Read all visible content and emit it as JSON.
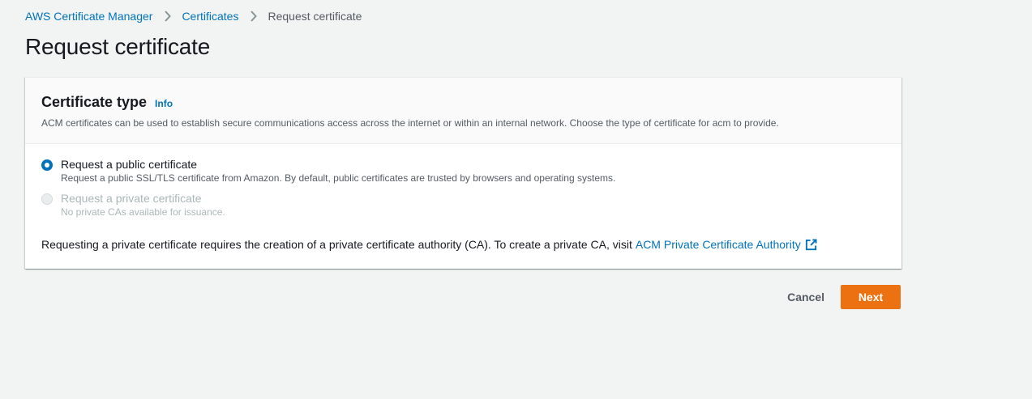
{
  "breadcrumb": {
    "items": [
      "AWS Certificate Manager",
      "Certificates"
    ],
    "current": "Request certificate"
  },
  "page": {
    "title": "Request certificate"
  },
  "panel": {
    "title": "Certificate type",
    "info": "Info",
    "description": "ACM certificates can be used to establish secure communications access across the internet or within an internal network. Choose the type of certificate for acm to provide.",
    "options": [
      {
        "label": "Request a public certificate",
        "description": "Request a public SSL/TLS certificate from Amazon. By default, public certificates are trusted by browsers and operating systems.",
        "selected": true,
        "disabled": false
      },
      {
        "label": "Request a private certificate",
        "description": "No private CAs available for issuance.",
        "selected": false,
        "disabled": true
      }
    ],
    "note": "Requesting a private certificate requires the creation of a private certificate authority (CA). To create a private CA, visit",
    "note_link": "ACM Private Certificate Authority",
    "note_link_icon": "external-link-icon"
  },
  "actions": {
    "cancel": "Cancel",
    "next": "Next"
  },
  "colors": {
    "link": "#0073bb",
    "primary": "#ec7211",
    "background": "#f2f3f3"
  }
}
